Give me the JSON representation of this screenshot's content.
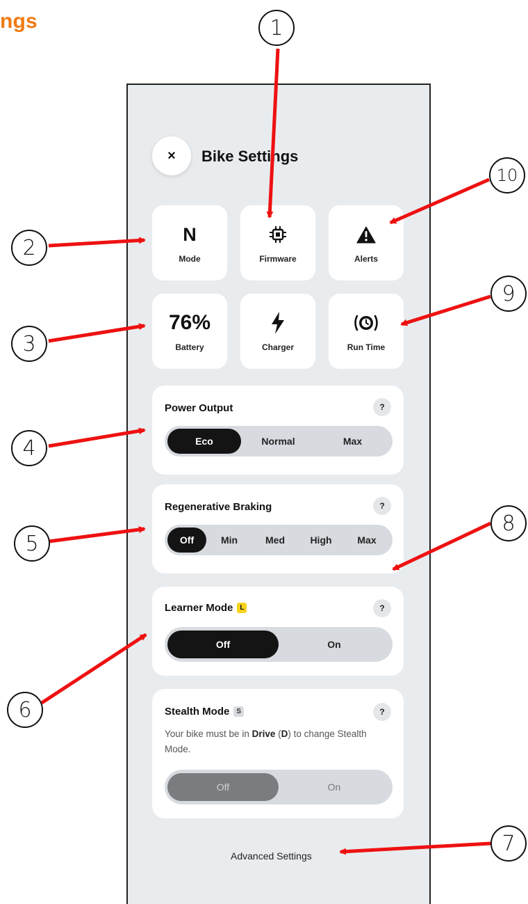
{
  "corner_title": "ngs",
  "header": {
    "close_label": "×",
    "title": "Bike Settings"
  },
  "tiles": [
    {
      "big": "N",
      "label": "Mode"
    },
    {
      "icon": "chip-icon",
      "label": "Firmware"
    },
    {
      "icon": "warning-icon",
      "label": "Alerts"
    },
    {
      "big": "76%",
      "label": "Battery"
    },
    {
      "icon": "lightning-icon",
      "label": "Charger"
    },
    {
      "icon": "clock-icon",
      "label": "Run Time"
    }
  ],
  "power_output": {
    "title": "Power Output",
    "help": "?",
    "options": [
      "Eco",
      "Normal",
      "Max"
    ],
    "selected": "Eco"
  },
  "regen_braking": {
    "title": "Regenerative Braking",
    "help": "?",
    "options": [
      "Off",
      "Min",
      "Med",
      "High",
      "Max"
    ],
    "selected": "Off"
  },
  "learner_mode": {
    "title": "Learner Mode",
    "badge": "L",
    "badge_color": "#f5d21c",
    "help": "?",
    "options": [
      "Off",
      "On"
    ],
    "selected": "Off"
  },
  "stealth_mode": {
    "title": "Stealth Mode",
    "badge": "S",
    "badge_color": "#d8dbdf",
    "help": "?",
    "description_pre": "Your bike must be in ",
    "description_bold1": "Drive",
    "description_mid": " (",
    "description_bold2": "D",
    "description_post": ") to change Stealth Mode.",
    "options": [
      "Off",
      "On"
    ],
    "selected": "Off",
    "disabled": true
  },
  "advanced_settings": "Advanced Settings",
  "callouts": [
    "1",
    "2",
    "3",
    "4",
    "5",
    "6",
    "7",
    "8",
    "9",
    "10"
  ],
  "colors": {
    "accent_orange": "#f07a12",
    "arrow_red": "#ee1111",
    "selected_dark": "#141414",
    "background": "#e9ecef"
  }
}
